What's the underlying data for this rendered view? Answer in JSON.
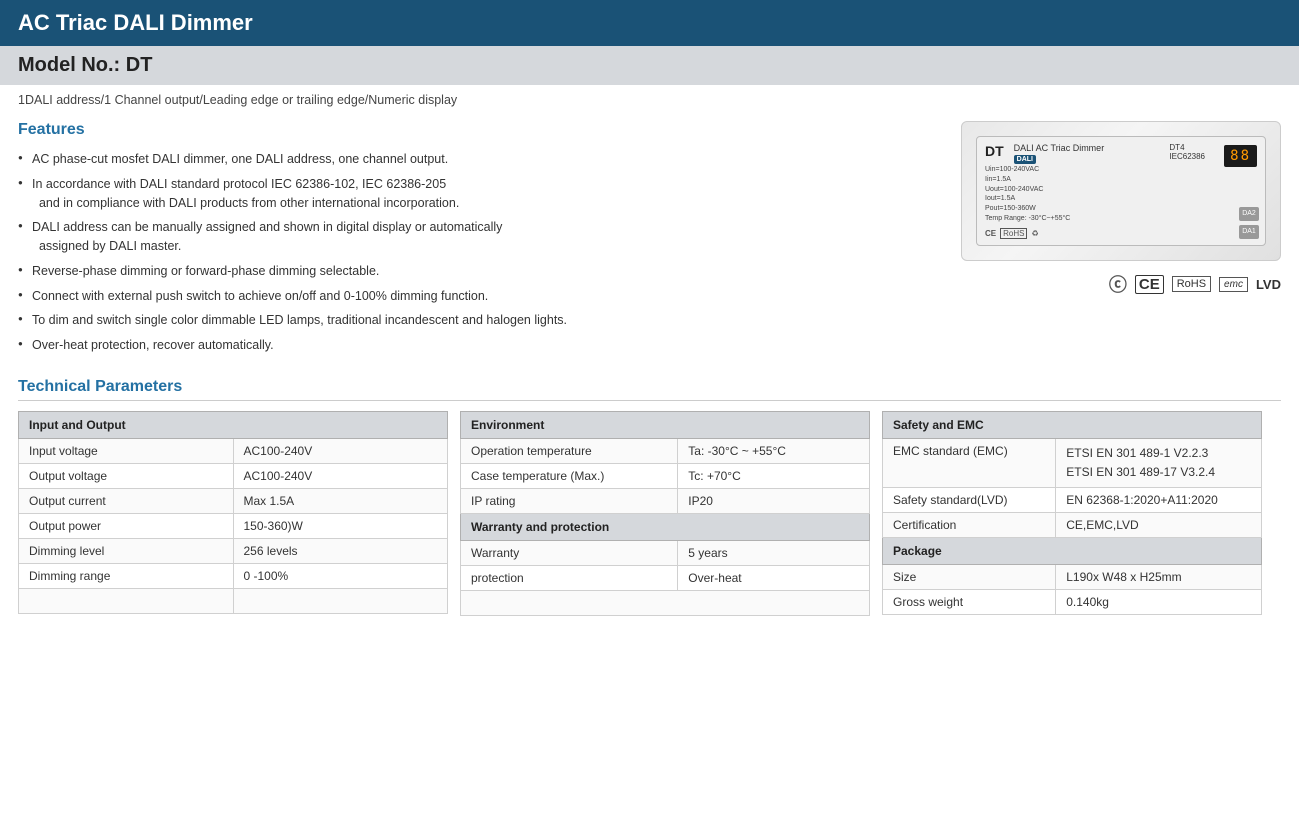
{
  "header": {
    "title": "AC Triac DALI Dimmer"
  },
  "model": {
    "label": "Model No.: DT"
  },
  "subtitle": "1DALI address/1 Channel output/Leading edge or trailing edge/Numeric display",
  "features": {
    "section_title": "Features",
    "items": [
      "AC phase-cut mosfet DALI dimmer, one DALI address, one channel output.",
      "In accordance with DALI standard protocol IEC 62386-102, IEC 62386-205\n      and in compliance with DALI products from other international incorporation.",
      "DALI address can be manually assigned and shown in digital display or automatically\n      assigned by DALI master.",
      "Reverse-phase dimming or forward-phase dimming selectable.",
      "Connect with external push switch to achieve on/off and 0-100% dimming function.",
      "To dim and switch single color dimmable LED lamps, traditional incandescent and halogen lights.",
      "Over-heat protection, recover automatically."
    ]
  },
  "product_image": {
    "model_name": "DT",
    "subtitle": "DALI AC Triac Dimmer",
    "dali_badge": "DALI",
    "spec_line1": "Uin=100-240VAC",
    "spec_line2": "Iin=1.5A",
    "spec_line3": "Uout=100-240VAC",
    "spec_line4": "Iout=1.5A",
    "spec_line5": "Pout=150-360W",
    "spec_line6": "Temp Range: -30°C~+55°C",
    "display": "88",
    "model_code": "DT4",
    "std": "IEC62386"
  },
  "certifications": {
    "items": [
      "C",
      "CE",
      "RoHS",
      "emc",
      "LVD"
    ]
  },
  "technical_params": {
    "section_title": "Technical Parameters",
    "table_io": {
      "header": "Input and Output",
      "rows": [
        {
          "label": "Input voltage",
          "value": "AC100-240V"
        },
        {
          "label": "Output voltage",
          "value": "AC100-240V"
        },
        {
          "label": "Output current",
          "value": "Max 1.5A"
        },
        {
          "label": "Output power",
          "value": "150-360)W"
        },
        {
          "label": "Dimming level",
          "value": "256 levels"
        },
        {
          "label": "Dimming range",
          "value": "0 -100%"
        }
      ]
    },
    "table_env": {
      "header": "Environment",
      "rows": [
        {
          "label": "Operation temperature",
          "value": "Ta: -30°C ~ +55°C"
        },
        {
          "label": "Case temperature (Max.)",
          "value": "Tc: +70°C"
        },
        {
          "label": "IP rating",
          "value": "IP20"
        }
      ],
      "header2": "Warranty and protection",
      "rows2": [
        {
          "label": "Warranty",
          "value": "5 years"
        },
        {
          "label": "protection",
          "value": "Over-heat"
        }
      ]
    },
    "table_safety": {
      "header": "Safety and EMC",
      "rows": [
        {
          "label": "EMC standard (EMC)",
          "value1": "ETSI EN 301 489-1 V2.2.3",
          "value2": "ETSI EN 301 489-17 V3.2.4"
        },
        {
          "label": "Safety standard(LVD)",
          "value": "EN 62368-1:2020+A11:2020"
        },
        {
          "label": "Certification",
          "value": "CE,EMC,LVD"
        }
      ],
      "header2": "Package",
      "rows2": [
        {
          "label": "Size",
          "value": "L190x W48 x H25mm"
        },
        {
          "label": "Gross weight",
          "value": "0.140kg"
        }
      ]
    }
  }
}
